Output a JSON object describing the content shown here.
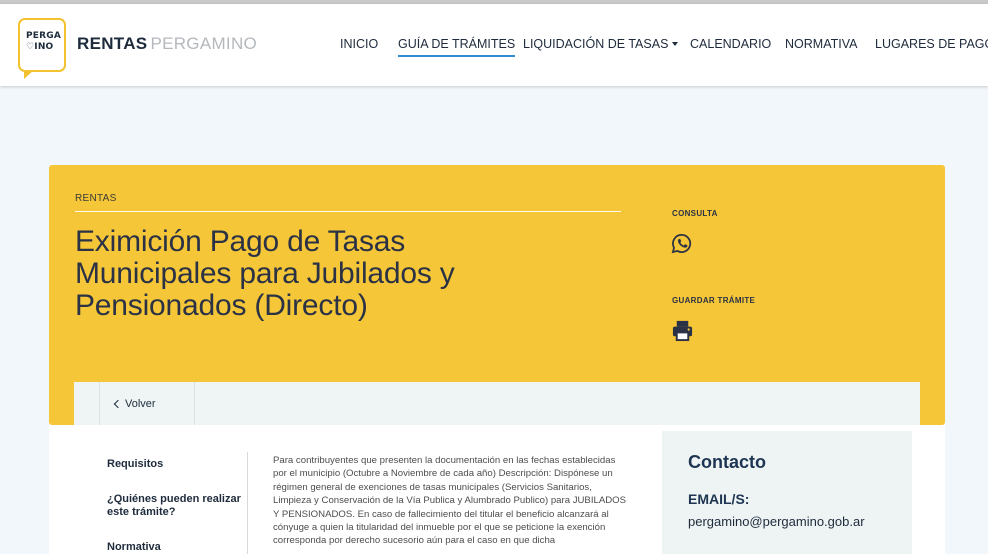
{
  "header": {
    "logo_line1": "PERGA",
    "logo_line2": "♡INO",
    "brand_strong": "RENTAS",
    "brand_light": "PERGAMINO",
    "nav": [
      "INICIO",
      "GUÍA DE TRÁMITES",
      "LIQUIDACIÓN DE TASAS",
      "CALENDARIO",
      "NORMATIVA",
      "LUGARES DE PAGO"
    ],
    "active_nav": "GUÍA DE TRÁMITES"
  },
  "hero": {
    "eyebrow": "RENTAS",
    "title": "Eximición Pago de Tasas Municipales para Jubilados y Pensionados (Directo)",
    "consulta_label": "CONSULTA",
    "consulta_icon": "whatsapp-icon",
    "guardar_label": "GUARDAR TRÁMITE",
    "guardar_icon": "printer-icon"
  },
  "subnav": {
    "back_label": "Volver",
    "back_icon": "chevron-left-icon"
  },
  "sidebar": {
    "items": [
      "Requisitos",
      "¿Quiénes pueden realizar este trámite?",
      "Normativa"
    ]
  },
  "main": {
    "text": "Para contribuyentes que presenten la documentación en las fechas establecidas por el municipio (Octubre a Noviembre de cada año) Descripción: Dispónese un régimen general de exenciones de tasas municipales (Servicios Sanitarios, Limpieza y Conservación de la Vía Publica y Alumbrado Publico) para JUBILADOS Y PENSIONADOS. En caso de fallecimiento del titular el beneficio alcanzará al cónyuge a quien la titularidad del inmueble por el que se peticione la exención corresponda por derecho sucesorio aún para el caso en que dicha"
  },
  "contact": {
    "title": "Contacto",
    "email_label": "EMAIL/S:",
    "email_value": "pergamino@pergamino.gob.ar"
  },
  "colors": {
    "accent_yellow": "#f5c637",
    "nav_active_underline": "#2f8fd3",
    "dark_text": "#1e2b3c",
    "contact_heading": "#1d3552"
  }
}
